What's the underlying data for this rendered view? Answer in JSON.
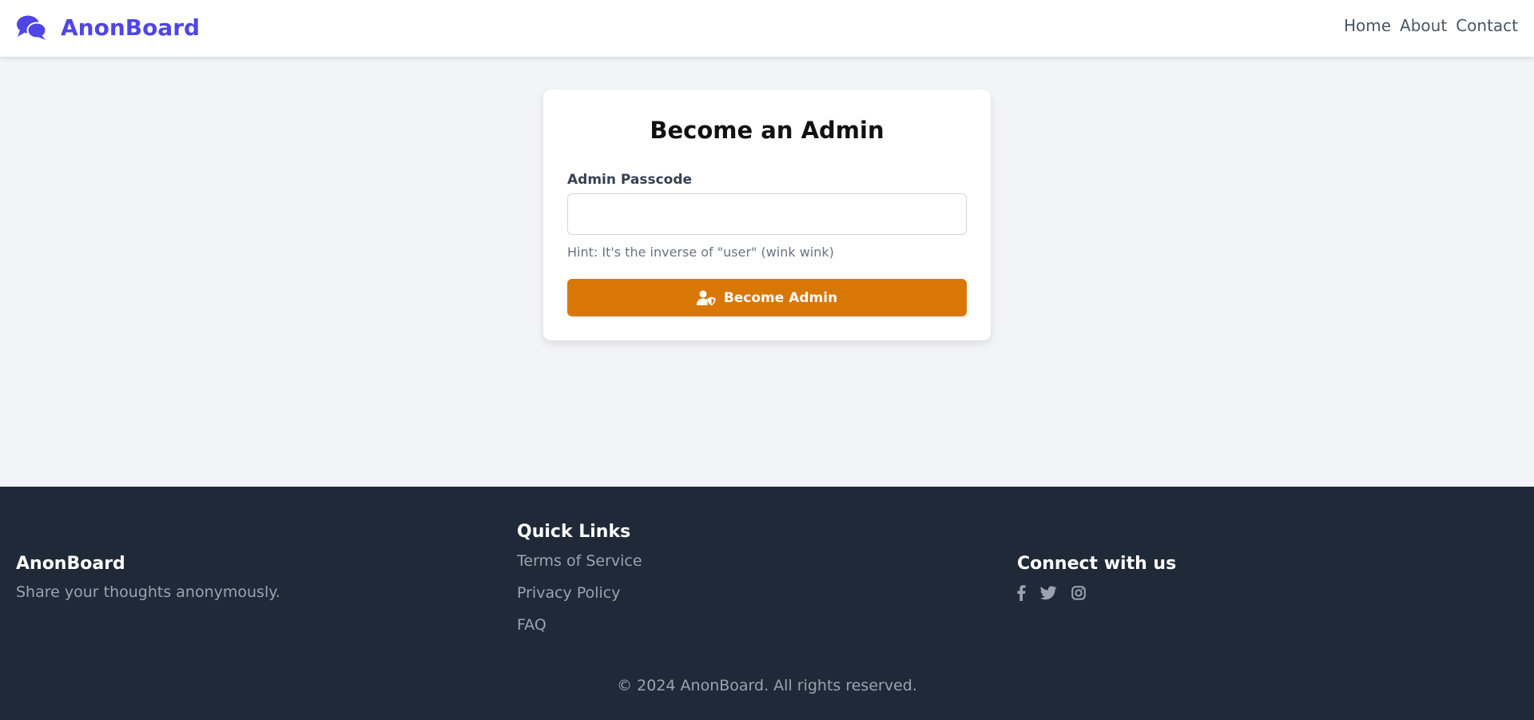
{
  "header": {
    "brand_name": "AnonBoard",
    "brand_icon": "comments-icon",
    "nav": [
      {
        "label": "Home"
      },
      {
        "label": "About"
      },
      {
        "label": "Contact"
      }
    ]
  },
  "admin_form": {
    "title": "Become an Admin",
    "passcode_label": "Admin Passcode",
    "passcode_value": "",
    "hint": "Hint: It's the inverse of \"user\" (wink wink)",
    "submit_label": "Become Admin",
    "submit_icon": "user-shield-icon"
  },
  "footer": {
    "brand_heading": "AnonBoard",
    "tagline": "Share your thoughts anonymously.",
    "links_heading": "Quick Links",
    "links": [
      {
        "label": "Terms of Service"
      },
      {
        "label": "Privacy Policy"
      },
      {
        "label": "FAQ"
      }
    ],
    "social_heading": "Connect with us",
    "social": [
      "facebook-icon",
      "twitter-icon",
      "instagram-icon"
    ],
    "copyright": "© 2024 AnonBoard. All rights reserved."
  },
  "colors": {
    "brand": "#4f46e5",
    "accent_button": "#d97706",
    "footer_bg": "#1f2937",
    "page_bg": "#f3f4f6"
  }
}
